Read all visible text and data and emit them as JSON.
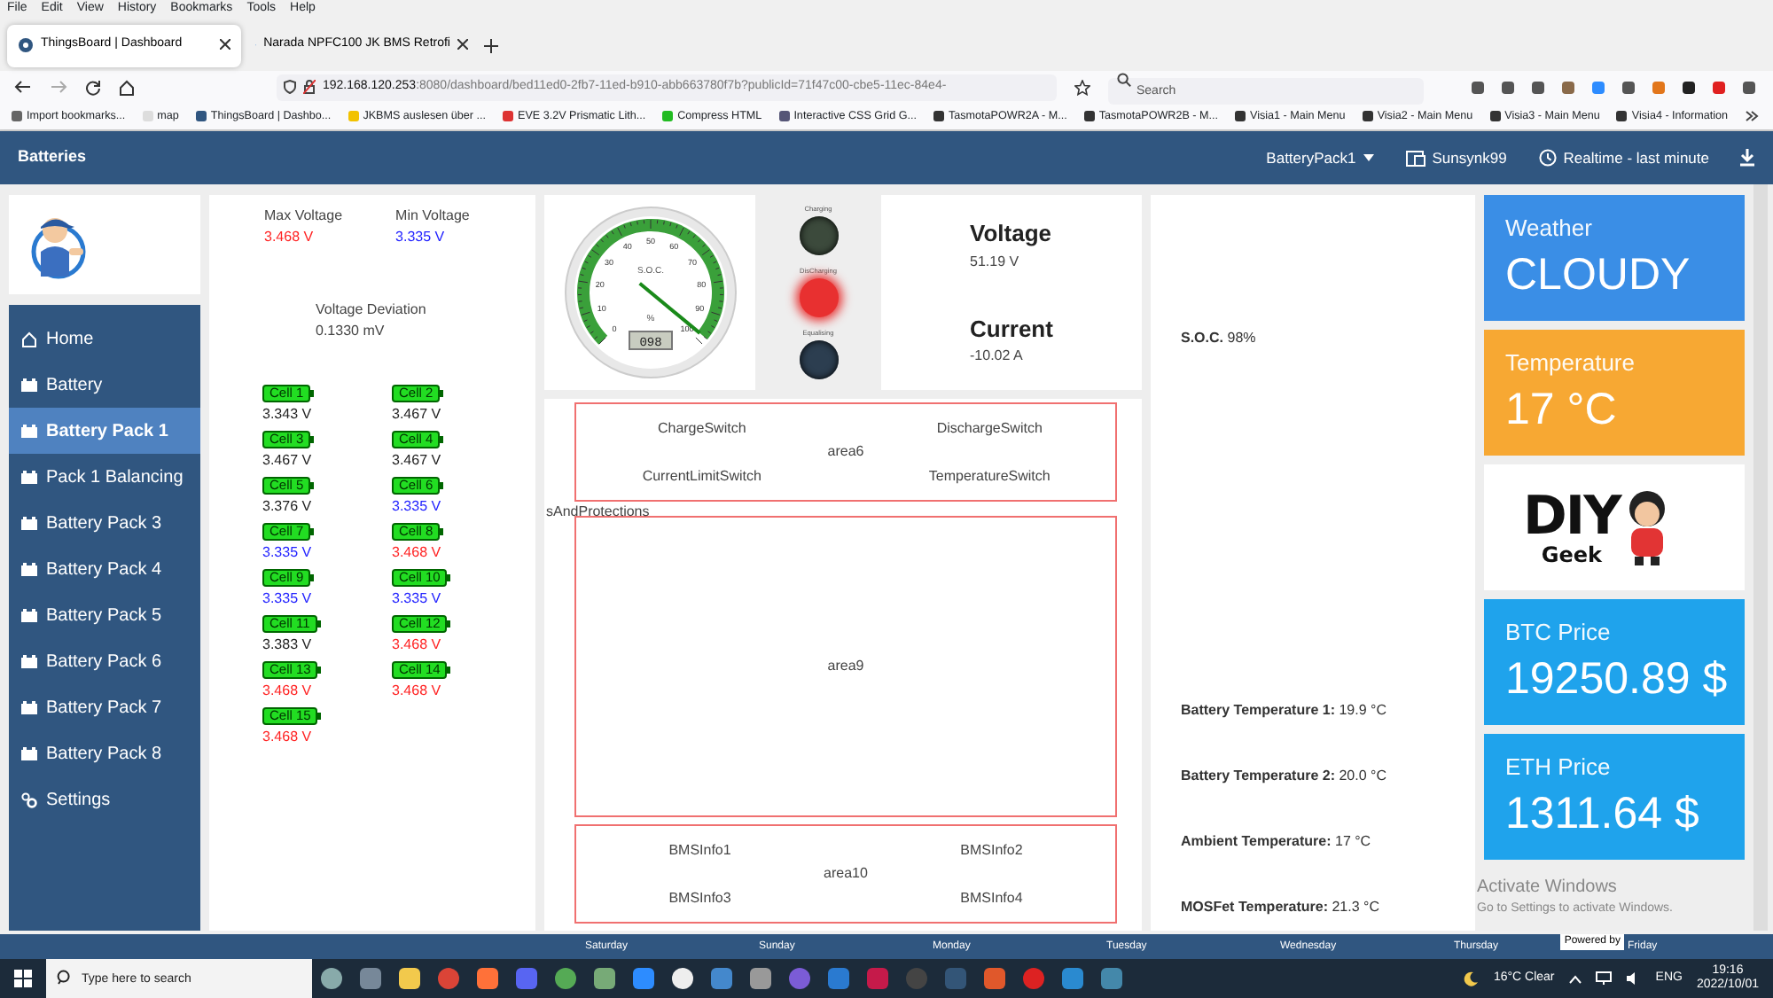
{
  "browser": {
    "menu": [
      "File",
      "Edit",
      "View",
      "History",
      "Bookmarks",
      "Tools",
      "Help"
    ],
    "tabs": [
      {
        "title": "ThingsBoard | Dashboard",
        "selected": true
      },
      {
        "title": "Narada NPFC100 JK BMS Retrofi",
        "selected": false
      }
    ],
    "url_host": "192.168.120.253",
    "url_rest": ":8080/dashboard/bed11ed0-2fb7-11ed-b910-abb663780f7b?publicId=71f47c00-cbe5-11ec-84e4-",
    "search_placeholder": "Search",
    "bookmarks": [
      "Import bookmarks...",
      "map",
      "ThingsBoard | Dashbo...",
      "JKBMS auslesen über ...",
      "EVE 3.2V Prismatic Lith...",
      "Compress HTML",
      "Interactive CSS Grid G...",
      "TasmotaPOWR2A - M...",
      "TasmotaPOWR2B - M...",
      "Visia1 - Main Menu",
      "Visia2 - Main Menu",
      "Visia3 - Main Menu",
      "Visia4 - Information"
    ]
  },
  "app": {
    "title": "Batteries",
    "entity": "BatteryPack1",
    "device": "Sunsynk99",
    "timewindow": "Realtime - last minute"
  },
  "sidebar": {
    "items": [
      {
        "label": "Home",
        "kind": "home",
        "selected": false
      },
      {
        "label": "Battery",
        "kind": "battery",
        "selected": false
      },
      {
        "label": "Battery Pack 1",
        "kind": "battery",
        "selected": true
      },
      {
        "label": "Pack 1 Balancing",
        "kind": "battery",
        "selected": false
      },
      {
        "label": "Battery Pack 3",
        "kind": "battery",
        "selected": false
      },
      {
        "label": "Battery Pack 4",
        "kind": "battery",
        "selected": false
      },
      {
        "label": "Battery Pack 5",
        "kind": "battery",
        "selected": false
      },
      {
        "label": "Battery Pack 6",
        "kind": "battery",
        "selected": false
      },
      {
        "label": "Battery Pack 7",
        "kind": "battery",
        "selected": false
      },
      {
        "label": "Battery Pack 8",
        "kind": "battery",
        "selected": false
      },
      {
        "label": "Settings",
        "kind": "settings",
        "selected": false
      }
    ]
  },
  "voltages": {
    "max": {
      "label": "Max Voltage",
      "value": "3.468 V",
      "color": "#ff2222"
    },
    "min": {
      "label": "Min Voltage",
      "value": "3.335 V",
      "color": "#2222ff"
    },
    "deviation": {
      "label": "Voltage Deviation",
      "value": "0.1330 mV"
    },
    "cells": [
      {
        "label": "Cell 1",
        "value": "3.343 V",
        "color": "#222222"
      },
      {
        "label": "Cell 2",
        "value": "3.467 V",
        "color": "#222222"
      },
      {
        "label": "Cell 3",
        "value": "3.467 V",
        "color": "#222222"
      },
      {
        "label": "Cell 4",
        "value": "3.467 V",
        "color": "#222222"
      },
      {
        "label": "Cell 5",
        "value": "3.376 V",
        "color": "#222222"
      },
      {
        "label": "Cell 6",
        "value": "3.335 V",
        "color": "#2222ff"
      },
      {
        "label": "Cell 7",
        "value": "3.335 V",
        "color": "#2222ff"
      },
      {
        "label": "Cell 8",
        "value": "3.468 V",
        "color": "#ff2222"
      },
      {
        "label": "Cell 9",
        "value": "3.335 V",
        "color": "#2222ff"
      },
      {
        "label": "Cell 10",
        "value": "3.335 V",
        "color": "#2222ff"
      },
      {
        "label": "Cell 11",
        "value": "3.383 V",
        "color": "#222222"
      },
      {
        "label": "Cell 12",
        "value": "3.468 V",
        "color": "#ff2222"
      },
      {
        "label": "Cell 13",
        "value": "3.468 V",
        "color": "#ff2222"
      },
      {
        "label": "Cell 14",
        "value": "3.468 V",
        "color": "#ff2222"
      },
      {
        "label": "Cell 15",
        "value": "3.468 V",
        "color": "#ff2222"
      }
    ]
  },
  "gauge": {
    "label": "S.O.C.",
    "unit": "%",
    "display": "098",
    "level": 0.98,
    "ticks": [
      "0",
      "10",
      "20",
      "30",
      "40",
      "50",
      "60",
      "70",
      "80",
      "90",
      "100"
    ]
  },
  "leds": [
    {
      "label": "Charging",
      "on": false,
      "color": "#3c4a3c"
    },
    {
      "label": "DisCharging",
      "on": true,
      "color": "#e83030"
    },
    {
      "label": "Equalising",
      "on": false,
      "color": "#2c3e50"
    }
  ],
  "readings": [
    {
      "title": "Voltage",
      "value": "51.19 V"
    },
    {
      "title": "Current",
      "value": "-10.02 A"
    }
  ],
  "areas": [
    {
      "label": "area6",
      "items": [
        "ChargeSwitch",
        "DischargeSwitch",
        "CurrentLimitSwitch",
        "TemperatureSwitch"
      ]
    },
    {
      "label": "area9"
    },
    {
      "label": "area10",
      "items": [
        "BMSInfo1",
        "BMSInfo2",
        "BMSInfo3",
        "BMSInfo4"
      ]
    }
  ],
  "overflow_label": "sAndProtections",
  "status": {
    "soc": {
      "label": "S.O.C.",
      "value": "98%"
    },
    "temperatures": [
      {
        "label": "Battery Temperature 1:",
        "value": "19.9 °C"
      },
      {
        "label": "Battery Temperature 2:",
        "value": "20.0 °C"
      },
      {
        "label": "Ambient Temperature:",
        "value": "17 °C"
      },
      {
        "label": "MOSFet Temperature:",
        "value": "21.3 °C"
      }
    ]
  },
  "tiles": [
    {
      "kind": "value",
      "title": "Weather",
      "value": "CLOUDY",
      "color": "#3a8ee6"
    },
    {
      "kind": "value",
      "title": "Temperature",
      "value": "17 °C",
      "color": "#f7a833"
    },
    {
      "kind": "logo",
      "title": "DIY",
      "value": "Geek",
      "color": "#ffffff"
    },
    {
      "kind": "value",
      "title": "BTC Price",
      "value": "19250.89 $",
      "color": "#1fa3ec"
    },
    {
      "kind": "value",
      "title": "ETH Price",
      "value": "1311.64 $",
      "color": "#1fa3ec"
    }
  ],
  "timeline": {
    "days": [
      "Saturday",
      "Sunday",
      "Monday",
      "Tuesday",
      "Wednesday",
      "Thursday",
      "Friday"
    ],
    "powered": "Powered by"
  },
  "os_notice": {
    "title": "Activate Windows",
    "text": "Go to Settings to activate Windows."
  },
  "taskbar": {
    "search_placeholder": "Type here to search",
    "weather": "16°C  Clear",
    "language": "ENG",
    "time": "19:16",
    "date": "2022/10/01"
  }
}
